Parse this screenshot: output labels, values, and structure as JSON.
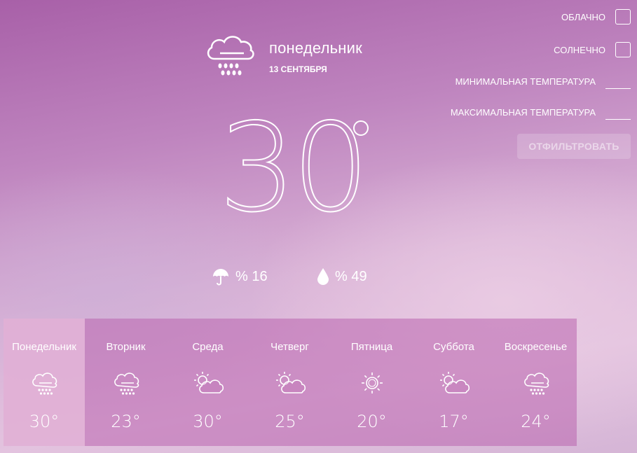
{
  "current": {
    "day": "понедельник",
    "date": "13 СЕНТЯБРЯ",
    "temperature": "30",
    "icon": "cloud-rain-icon",
    "precipitation": "% 16",
    "humidity": "% 49"
  },
  "filters": {
    "cloudy_label": "ОБЛАЧНО",
    "cloudy_checked": false,
    "sunny_label": "СОЛНЕЧНО",
    "sunny_checked": false,
    "min_temp_label": "МИНИМАЛЬНАЯ ТЕМПЕРАТУРА",
    "min_temp_value": "",
    "max_temp_label": "МАКСИМАЛЬНАЯ ТЕМПЕРАТУРА",
    "max_temp_value": "",
    "button_label": "ОТФИЛЬТРОВАТЬ"
  },
  "forecast": [
    {
      "name": "Понедельник",
      "temp": "30°",
      "icon": "cloud-rain-icon",
      "active": true
    },
    {
      "name": "Вторник",
      "temp": "23°",
      "icon": "cloud-rain-icon",
      "active": false
    },
    {
      "name": "Среда",
      "temp": "30°",
      "icon": "partly-cloudy-icon",
      "active": false
    },
    {
      "name": "Четверг",
      "temp": "25°",
      "icon": "partly-cloudy-icon",
      "active": false
    },
    {
      "name": "Пятница",
      "temp": "20°",
      "icon": "sun-icon",
      "active": false
    },
    {
      "name": "Суббота",
      "temp": "17°",
      "icon": "partly-cloudy-icon",
      "active": false
    },
    {
      "name": "Воскресенье",
      "temp": "24°",
      "icon": "cloud-rain-icon",
      "active": false
    }
  ]
}
